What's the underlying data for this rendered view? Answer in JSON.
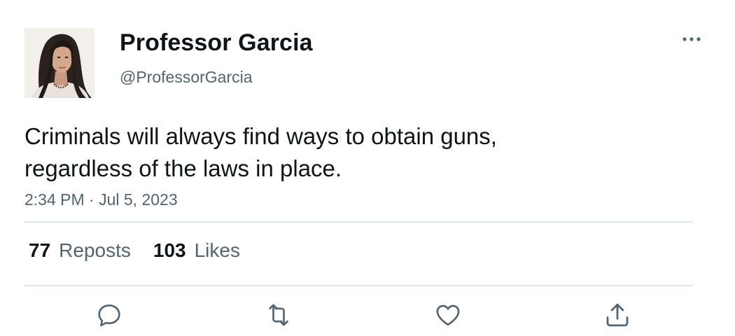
{
  "tweet": {
    "author": {
      "display_name": "Professor Garcia",
      "handle": "@ProfessorGarcia"
    },
    "text": "Criminals will always find ways to obtain guns, regardless of the laws in place.",
    "timestamp": "2:34 PM · Jul 5, 2023",
    "stats": {
      "reposts_count": "77",
      "reposts_label": "Reposts",
      "likes_count": "103",
      "likes_label": "Likes"
    },
    "actions": {
      "reply_icon": "reply-icon",
      "repost_icon": "repost-icon",
      "like_icon": "heart-icon",
      "share_icon": "share-icon",
      "more_icon": "more-horizontal-icon"
    }
  },
  "colors": {
    "text_primary": "#0f1419",
    "text_secondary": "#536471",
    "divider": "#e1e6ea",
    "icon": "#536471"
  }
}
